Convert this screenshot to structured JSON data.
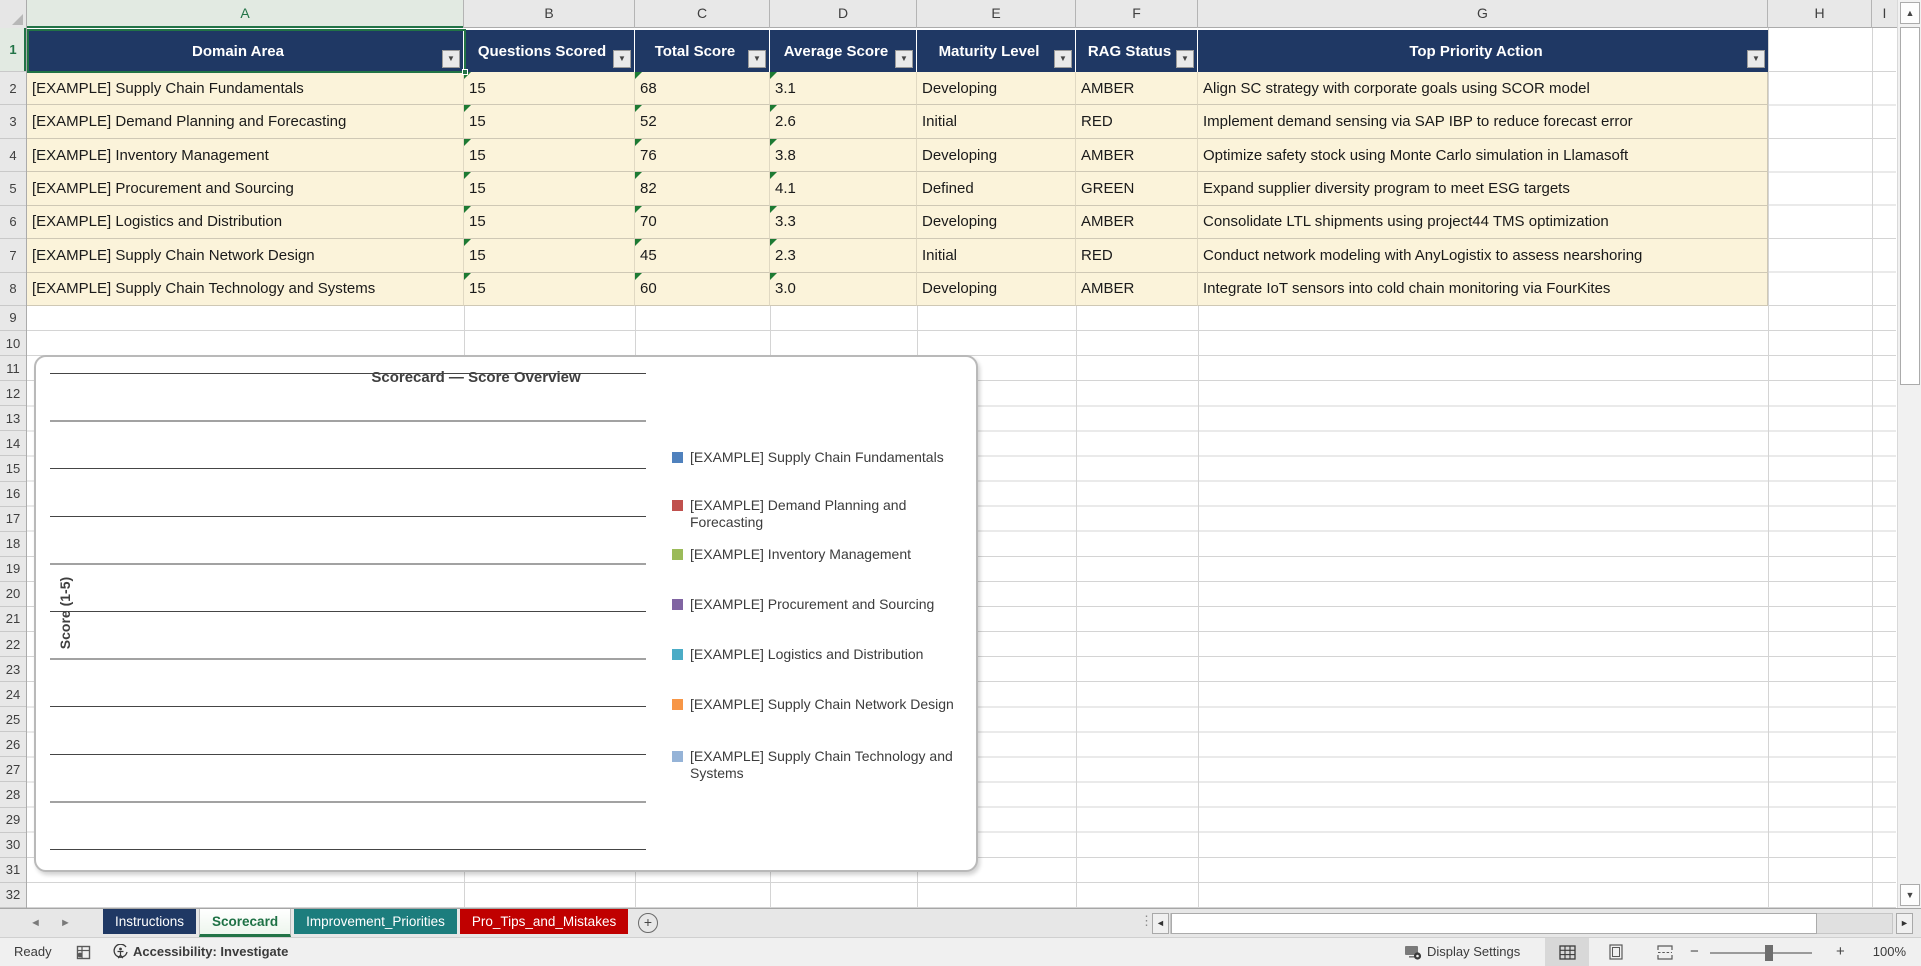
{
  "grid": {
    "column_letters": [
      "A",
      "B",
      "C",
      "D",
      "E",
      "F",
      "G",
      "H",
      "I"
    ],
    "row_numbers": [
      "1",
      "2",
      "3",
      "4",
      "5",
      "6",
      "7",
      "8",
      "9",
      "10",
      "11",
      "12",
      "13",
      "14",
      "15",
      "16",
      "17",
      "18",
      "19",
      "20",
      "21",
      "22",
      "23",
      "24",
      "25",
      "26",
      "27",
      "28",
      "29",
      "30",
      "31",
      "32"
    ]
  },
  "table": {
    "headers": [
      "Domain Area",
      "Questions Scored",
      "Total Score",
      "Average Score",
      "Maturity Level",
      "RAG Status",
      "Top Priority Action"
    ],
    "rows": [
      {
        "domain": "[EXAMPLE] Supply Chain Fundamentals",
        "questions": "15",
        "total": "68",
        "avg": "3.1",
        "maturity": "Developing",
        "rag": "AMBER",
        "action": "Align SC strategy with corporate goals using SCOR model"
      },
      {
        "domain": "[EXAMPLE] Demand Planning and Forecasting",
        "questions": "15",
        "total": "52",
        "avg": "2.6",
        "maturity": "Initial",
        "rag": "RED",
        "action": "Implement demand sensing via SAP IBP to reduce forecast error"
      },
      {
        "domain": "[EXAMPLE] Inventory Management",
        "questions": "15",
        "total": "76",
        "avg": "3.8",
        "maturity": "Developing",
        "rag": "AMBER",
        "action": "Optimize safety stock using Monte Carlo simulation in Llamasoft"
      },
      {
        "domain": "[EXAMPLE] Procurement and Sourcing",
        "questions": "15",
        "total": "82",
        "avg": "4.1",
        "maturity": "Defined",
        "rag": "GREEN",
        "action": "Expand supplier diversity program to meet ESG targets"
      },
      {
        "domain": "[EXAMPLE] Logistics and Distribution",
        "questions": "15",
        "total": "70",
        "avg": "3.3",
        "maturity": "Developing",
        "rag": "AMBER",
        "action": "Consolidate LTL shipments using project44 TMS optimization"
      },
      {
        "domain": "[EXAMPLE] Supply Chain Network Design",
        "questions": "15",
        "total": "45",
        "avg": "2.3",
        "maturity": "Initial",
        "rag": "RED",
        "action": "Conduct network modeling with AnyLogistix to assess nearshoring"
      },
      {
        "domain": "[EXAMPLE] Supply Chain Technology and Systems",
        "questions": "15",
        "total": "60",
        "avg": "3.0",
        "maturity": "Developing",
        "rag": "AMBER",
        "action": "Integrate IoT sensors into cold chain monitoring via FourKites"
      }
    ]
  },
  "chart": {
    "title": "Scorecard — Score Overview",
    "y_axis_label": "Score (1-5)",
    "legend": [
      {
        "label": "[EXAMPLE] Supply Chain Fundamentals",
        "color": "#4F81BD"
      },
      {
        "label": "[EXAMPLE] Demand Planning and Forecasting",
        "color": "#C0504D"
      },
      {
        "label": "[EXAMPLE] Inventory Management",
        "color": "#9BBB59"
      },
      {
        "label": "[EXAMPLE] Procurement and Sourcing",
        "color": "#8064A2"
      },
      {
        "label": "[EXAMPLE] Logistics and Distribution",
        "color": "#4BACC6"
      },
      {
        "label": "[EXAMPLE] Supply Chain Network Design",
        "color": "#F79646"
      },
      {
        "label": "[EXAMPLE] Supply Chain Technology and Systems",
        "color": "#95B3D7"
      }
    ]
  },
  "chart_data": {
    "type": "bar",
    "title": "Scorecard — Score Overview",
    "xlabel": "",
    "ylabel": "Score (1-5)",
    "ylim": [
      0,
      5
    ],
    "gridline_step": 0.5,
    "gridlines_visible": 11,
    "legend_position": "right",
    "series": [
      {
        "name": "[EXAMPLE] Supply Chain Fundamentals",
        "color": "#4F81BD",
        "values": []
      },
      {
        "name": "[EXAMPLE] Demand Planning and Forecasting",
        "color": "#C0504D",
        "values": []
      },
      {
        "name": "[EXAMPLE] Inventory Management",
        "color": "#9BBB59",
        "values": []
      },
      {
        "name": "[EXAMPLE] Procurement and Sourcing",
        "color": "#8064A2",
        "values": []
      },
      {
        "name": "[EXAMPLE] Logistics and Distribution",
        "color": "#4BACC6",
        "values": []
      },
      {
        "name": "[EXAMPLE] Supply Chain Network Design",
        "color": "#F79646",
        "values": []
      },
      {
        "name": "[EXAMPLE] Supply Chain Technology and Systems",
        "color": "#95B3D7",
        "values": []
      }
    ],
    "note": "Plot area renders empty: gridlines only, no bars and no axis tick labels visible"
  },
  "sheet_tabs": {
    "tabs": [
      {
        "label": "Instructions",
        "color": "#1F3864",
        "active": false
      },
      {
        "label": "Scorecard",
        "color": "#217346",
        "active": true
      },
      {
        "label": "Improvement_Priorities",
        "color": "#1C7D7D",
        "active": false
      },
      {
        "label": "Pro_Tips_and_Mistakes",
        "color": "#C00000",
        "active": false
      }
    ]
  },
  "icons": {
    "filter_dropdown": "▼",
    "sheet_nav_left": "◄",
    "sheet_nav_right": "►",
    "add_sheet": "+",
    "tab_overflow_dots": "⋮",
    "hscroll_left": "◄",
    "hscroll_right": "►",
    "vscroll_up": "▲",
    "vscroll_down": "▼"
  },
  "status_bar": {
    "ready": "Ready",
    "accessibility": "Accessibility: Investigate",
    "display_settings": "Display Settings",
    "zoom_out": "−",
    "zoom_in": "+",
    "zoom_level": "100%"
  },
  "colors": {
    "table_header_bg": "#1F3864",
    "table_row_bg": "#FBF3DA",
    "selection_accent": "#217346",
    "tab_red": "#C00000",
    "tab_teal": "#1C7D7D",
    "tab_navy": "#1F3864"
  }
}
